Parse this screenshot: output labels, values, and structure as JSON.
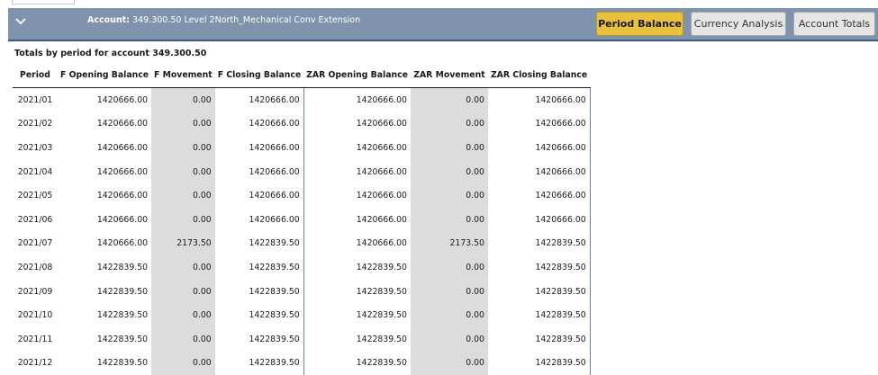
{
  "header": {
    "account_label": "Account:",
    "account_value": "349.300.50  Level 2North_Mechanical Conv Extension",
    "buttons": {
      "period_balance": "Period Balance",
      "currency_analysis": "Currency Analysis",
      "account_totals": "Account Totals"
    },
    "active_tab": "Period Balance",
    "colors": {
      "header_bg": "#8093ad",
      "active_button": "#e8c13f"
    }
  },
  "table": {
    "title": "Totals by period for account 349.300.50",
    "columns": [
      "Period",
      "F Opening Balance",
      "F Movement",
      "F Closing Balance",
      "ZAR Opening Balance",
      "ZAR Movement",
      "ZAR Closing Balance"
    ],
    "rows": [
      [
        "2021/01",
        "1420666.00",
        "0.00",
        "1420666.00",
        "1420666.00",
        "0.00",
        "1420666.00"
      ],
      [
        "2021/02",
        "1420666.00",
        "0.00",
        "1420666.00",
        "1420666.00",
        "0.00",
        "1420666.00"
      ],
      [
        "2021/03",
        "1420666.00",
        "0.00",
        "1420666.00",
        "1420666.00",
        "0.00",
        "1420666.00"
      ],
      [
        "2021/04",
        "1420666.00",
        "0.00",
        "1420666.00",
        "1420666.00",
        "0.00",
        "1420666.00"
      ],
      [
        "2021/05",
        "1420666.00",
        "0.00",
        "1420666.00",
        "1420666.00",
        "0.00",
        "1420666.00"
      ],
      [
        "2021/06",
        "1420666.00",
        "0.00",
        "1420666.00",
        "1420666.00",
        "0.00",
        "1420666.00"
      ],
      [
        "2021/07",
        "1420666.00",
        "2173.50",
        "1422839.50",
        "1420666.00",
        "2173.50",
        "1422839.50"
      ],
      [
        "2021/08",
        "1422839.50",
        "0.00",
        "1422839.50",
        "1422839.50",
        "0.00",
        "1422839.50"
      ],
      [
        "2021/09",
        "1422839.50",
        "0.00",
        "1422839.50",
        "1422839.50",
        "0.00",
        "1422839.50"
      ],
      [
        "2021/10",
        "1422839.50",
        "0.00",
        "1422839.50",
        "1422839.50",
        "0.00",
        "1422839.50"
      ],
      [
        "2021/11",
        "1422839.50",
        "0.00",
        "1422839.50",
        "1422839.50",
        "0.00",
        "1422839.50"
      ],
      [
        "2021/12",
        "1422839.50",
        "0.00",
        "1422839.50",
        "1422839.50",
        "0.00",
        "1422839.50"
      ]
    ]
  }
}
